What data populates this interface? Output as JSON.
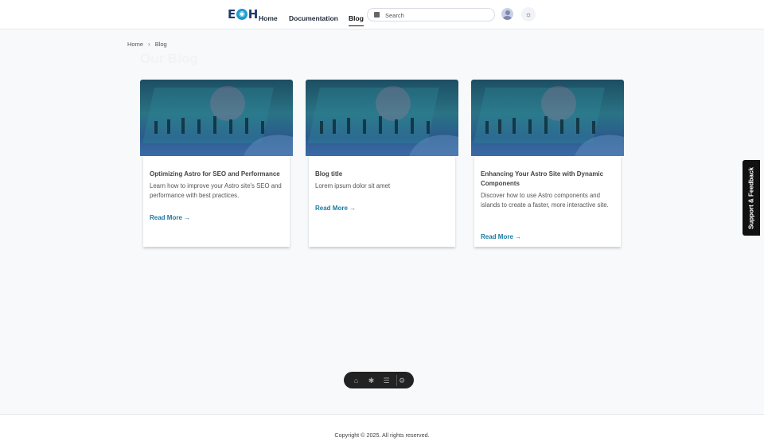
{
  "header": {
    "logo": "EOH",
    "nav": [
      "Home",
      "Documentation",
      "Blog"
    ],
    "search_placeholder": "Search"
  },
  "breadcrumb": [
    "Home",
    "Blog"
  ],
  "page_title": "Our Blog",
  "cards": [
    {
      "title": "Optimizing Astro for SEO and Performance",
      "description": "Learn how to improve your Astro site's SEO and performance with best practices.",
      "link": "Read More →"
    },
    {
      "title": "Blog title",
      "description": "Lorem ipsum dolor sit amet",
      "link": "Read More →"
    },
    {
      "title": "Enhancing Your Astro Site with Dynamic Components",
      "description": "Discover how to use Astro components and islands to create a faster, more interactive site.",
      "link": "Read More →"
    }
  ],
  "feedback_tab": "Support & Feedback",
  "footer": "Copyright © 2025. All rights reserved.",
  "colors": {
    "link": "#1a7aa3",
    "toolbar": "#222222",
    "feedback": "#111111"
  }
}
